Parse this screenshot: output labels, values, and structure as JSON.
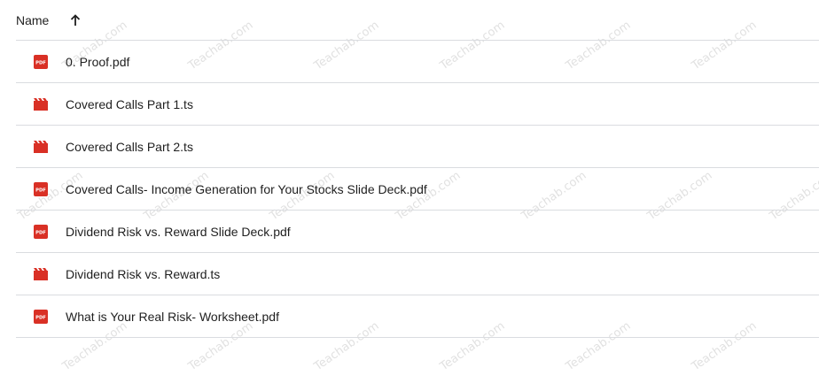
{
  "header": {
    "name_label": "Name",
    "sort_icon": "arrow-up-icon"
  },
  "files": [
    {
      "name": "0. Proof.pdf",
      "icon": "pdf-icon"
    },
    {
      "name": "Covered Calls Part 1.ts",
      "icon": "video-icon"
    },
    {
      "name": "Covered Calls Part 2.ts",
      "icon": "video-icon"
    },
    {
      "name": "Covered Calls- Income Generation for Your Stocks Slide Deck.pdf",
      "icon": "pdf-icon"
    },
    {
      "name": "Dividend Risk vs. Reward Slide Deck.pdf",
      "icon": "pdf-icon"
    },
    {
      "name": "Dividend Risk vs. Reward.ts",
      "icon": "video-icon"
    },
    {
      "name": "What is Your Real Risk- Worksheet.pdf",
      "icon": "pdf-icon"
    }
  ],
  "watermark": {
    "text": "Teachab.com"
  },
  "colors": {
    "icon_red": "#d93025",
    "divider": "#dadce0",
    "text": "#1f1f1f"
  }
}
